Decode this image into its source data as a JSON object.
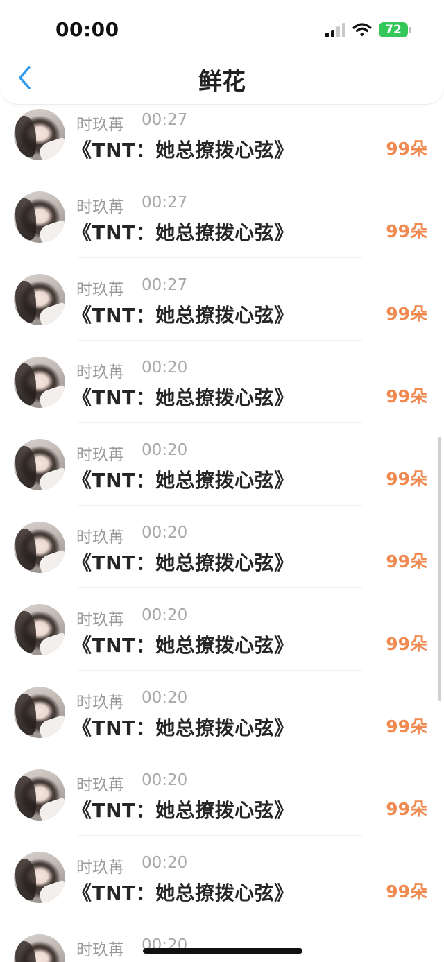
{
  "status_bar": {
    "time": "00:00",
    "battery": "72"
  },
  "header": {
    "title": "鲜花"
  },
  "gifts": [
    {
      "sender": "时玖苒",
      "time": "00:27",
      "book": "《TNT：她总撩拨心弦》",
      "amount": "99朵"
    },
    {
      "sender": "时玖苒",
      "time": "00:27",
      "book": "《TNT：她总撩拨心弦》",
      "amount": "99朵"
    },
    {
      "sender": "时玖苒",
      "time": "00:27",
      "book": "《TNT：她总撩拨心弦》",
      "amount": "99朵"
    },
    {
      "sender": "时玖苒",
      "time": "00:20",
      "book": "《TNT：她总撩拨心弦》",
      "amount": "99朵"
    },
    {
      "sender": "时玖苒",
      "time": "00:20",
      "book": "《TNT：她总撩拨心弦》",
      "amount": "99朵"
    },
    {
      "sender": "时玖苒",
      "time": "00:20",
      "book": "《TNT：她总撩拨心弦》",
      "amount": "99朵"
    },
    {
      "sender": "时玖苒",
      "time": "00:20",
      "book": "《TNT：她总撩拨心弦》",
      "amount": "99朵"
    },
    {
      "sender": "时玖苒",
      "time": "00:20",
      "book": "《TNT：她总撩拨心弦》",
      "amount": "99朵"
    },
    {
      "sender": "时玖苒",
      "time": "00:20",
      "book": "《TNT：她总撩拨心弦》",
      "amount": "99朵"
    },
    {
      "sender": "时玖苒",
      "time": "00:20",
      "book": "《TNT：她总撩拨心弦》",
      "amount": "99朵"
    },
    {
      "sender": "时玖苒",
      "time": "00:20",
      "book": "",
      "amount": ""
    }
  ]
}
